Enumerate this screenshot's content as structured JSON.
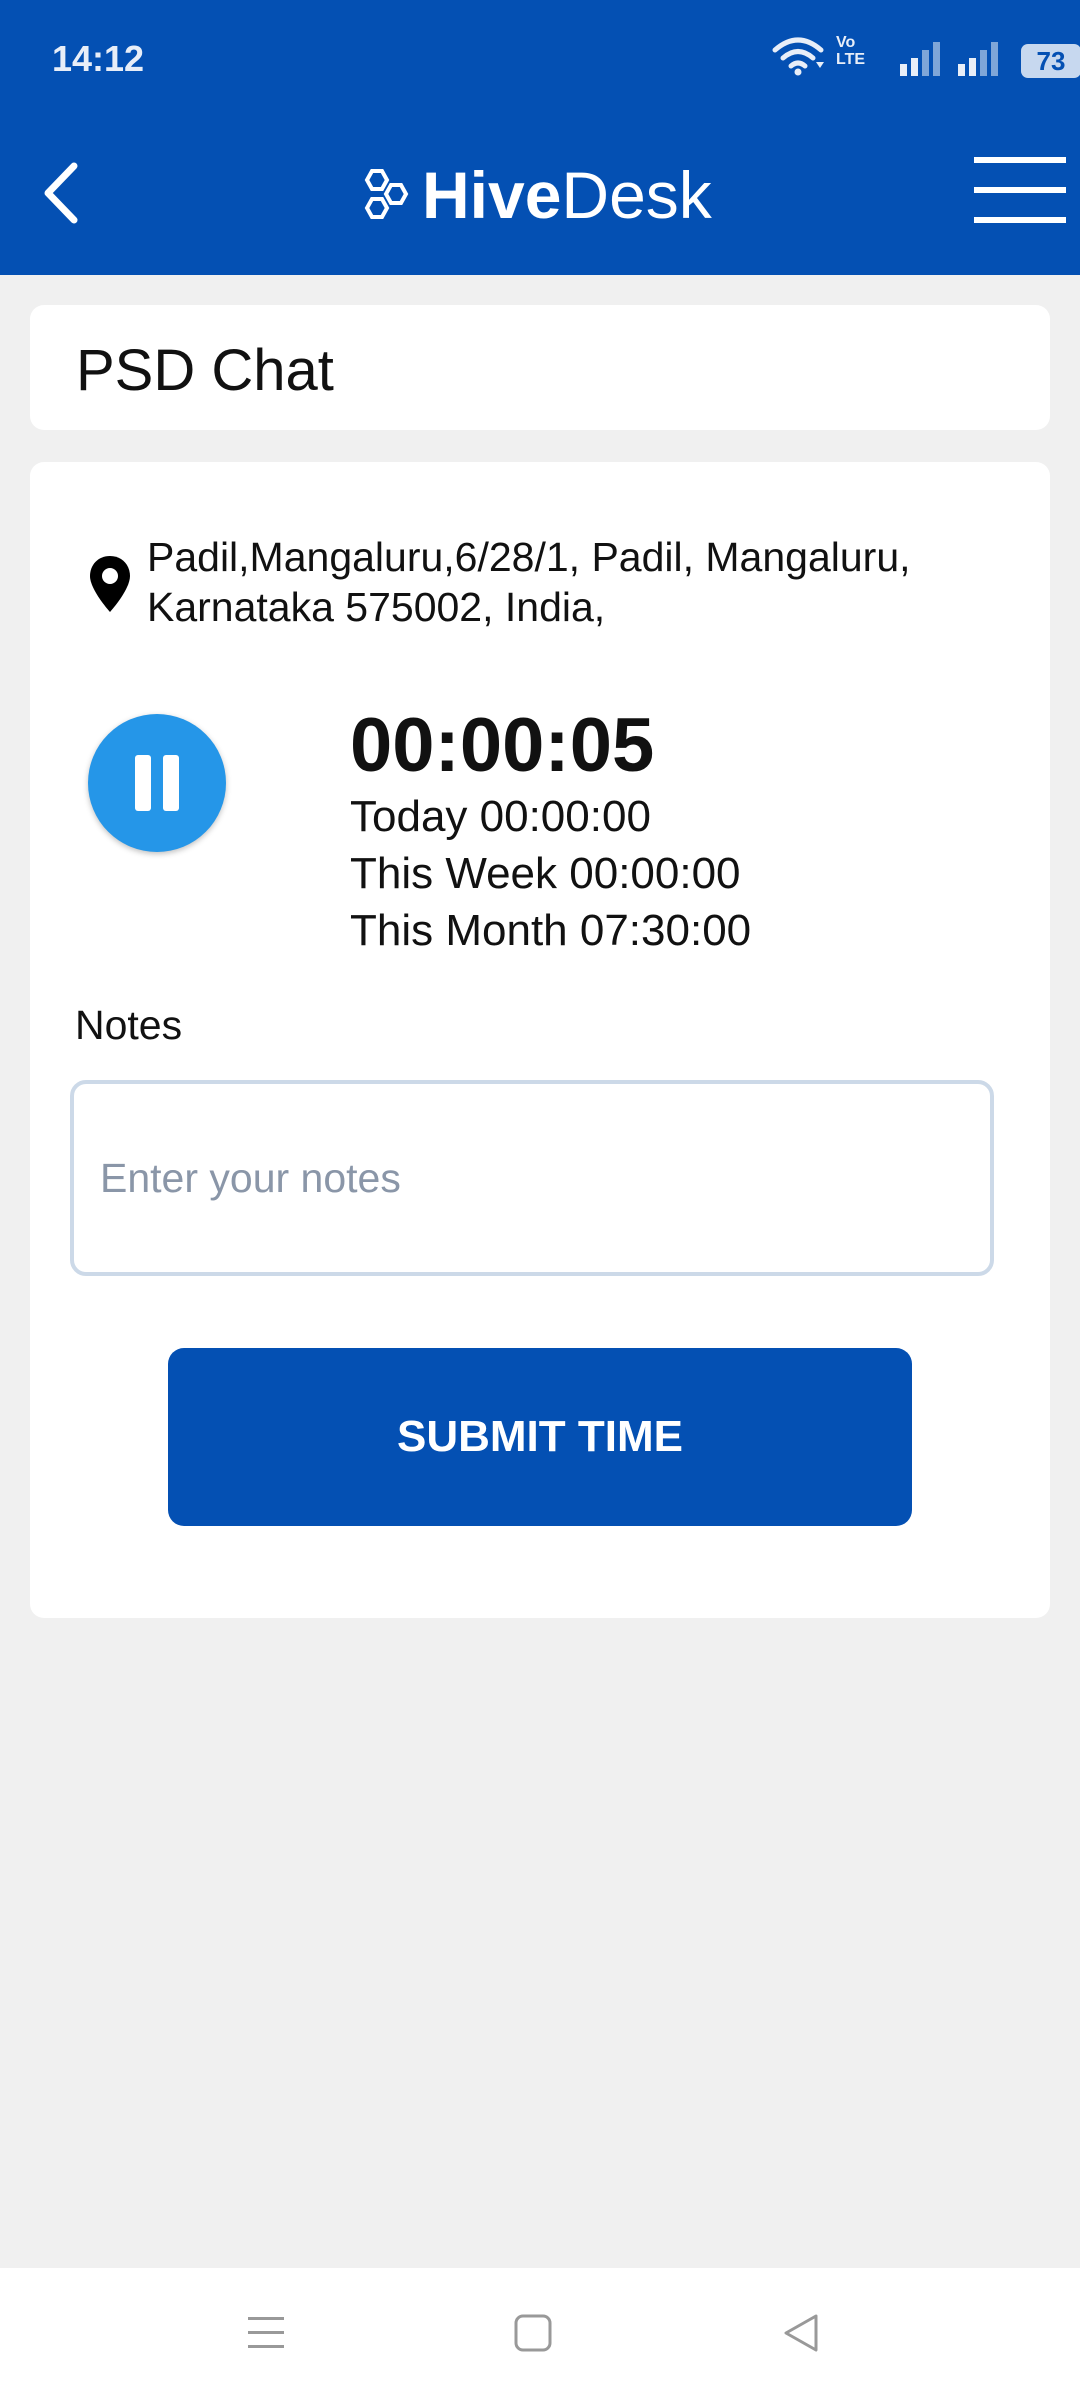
{
  "status_bar": {
    "time": "14:12",
    "network_label_top": "Vo",
    "network_label_bottom": "LTE",
    "battery": "73"
  },
  "header": {
    "logo_bold": "Hive",
    "logo_light": "Desk",
    "back_icon": "chevron-left-icon",
    "menu_icon": "hamburger-menu-icon",
    "background_color": "#0450b3"
  },
  "page": {
    "title": "PSD Chat"
  },
  "tracker": {
    "address": "Padil,Mangaluru,6/28/1, Padil, Mangaluru, Karnataka 575002, India,",
    "timer": "00:00:05",
    "today": "Today 00:00:00",
    "this_week": "This Week 00:00:00",
    "this_month": "This Month 07:30:00",
    "pause_button_color": "#2596e8"
  },
  "notes": {
    "label": "Notes",
    "placeholder": "Enter your notes",
    "value": ""
  },
  "actions": {
    "submit_label": "SUBMIT TIME"
  },
  "system_nav": {
    "items": [
      "menu-icon",
      "home-icon",
      "back-icon"
    ]
  }
}
